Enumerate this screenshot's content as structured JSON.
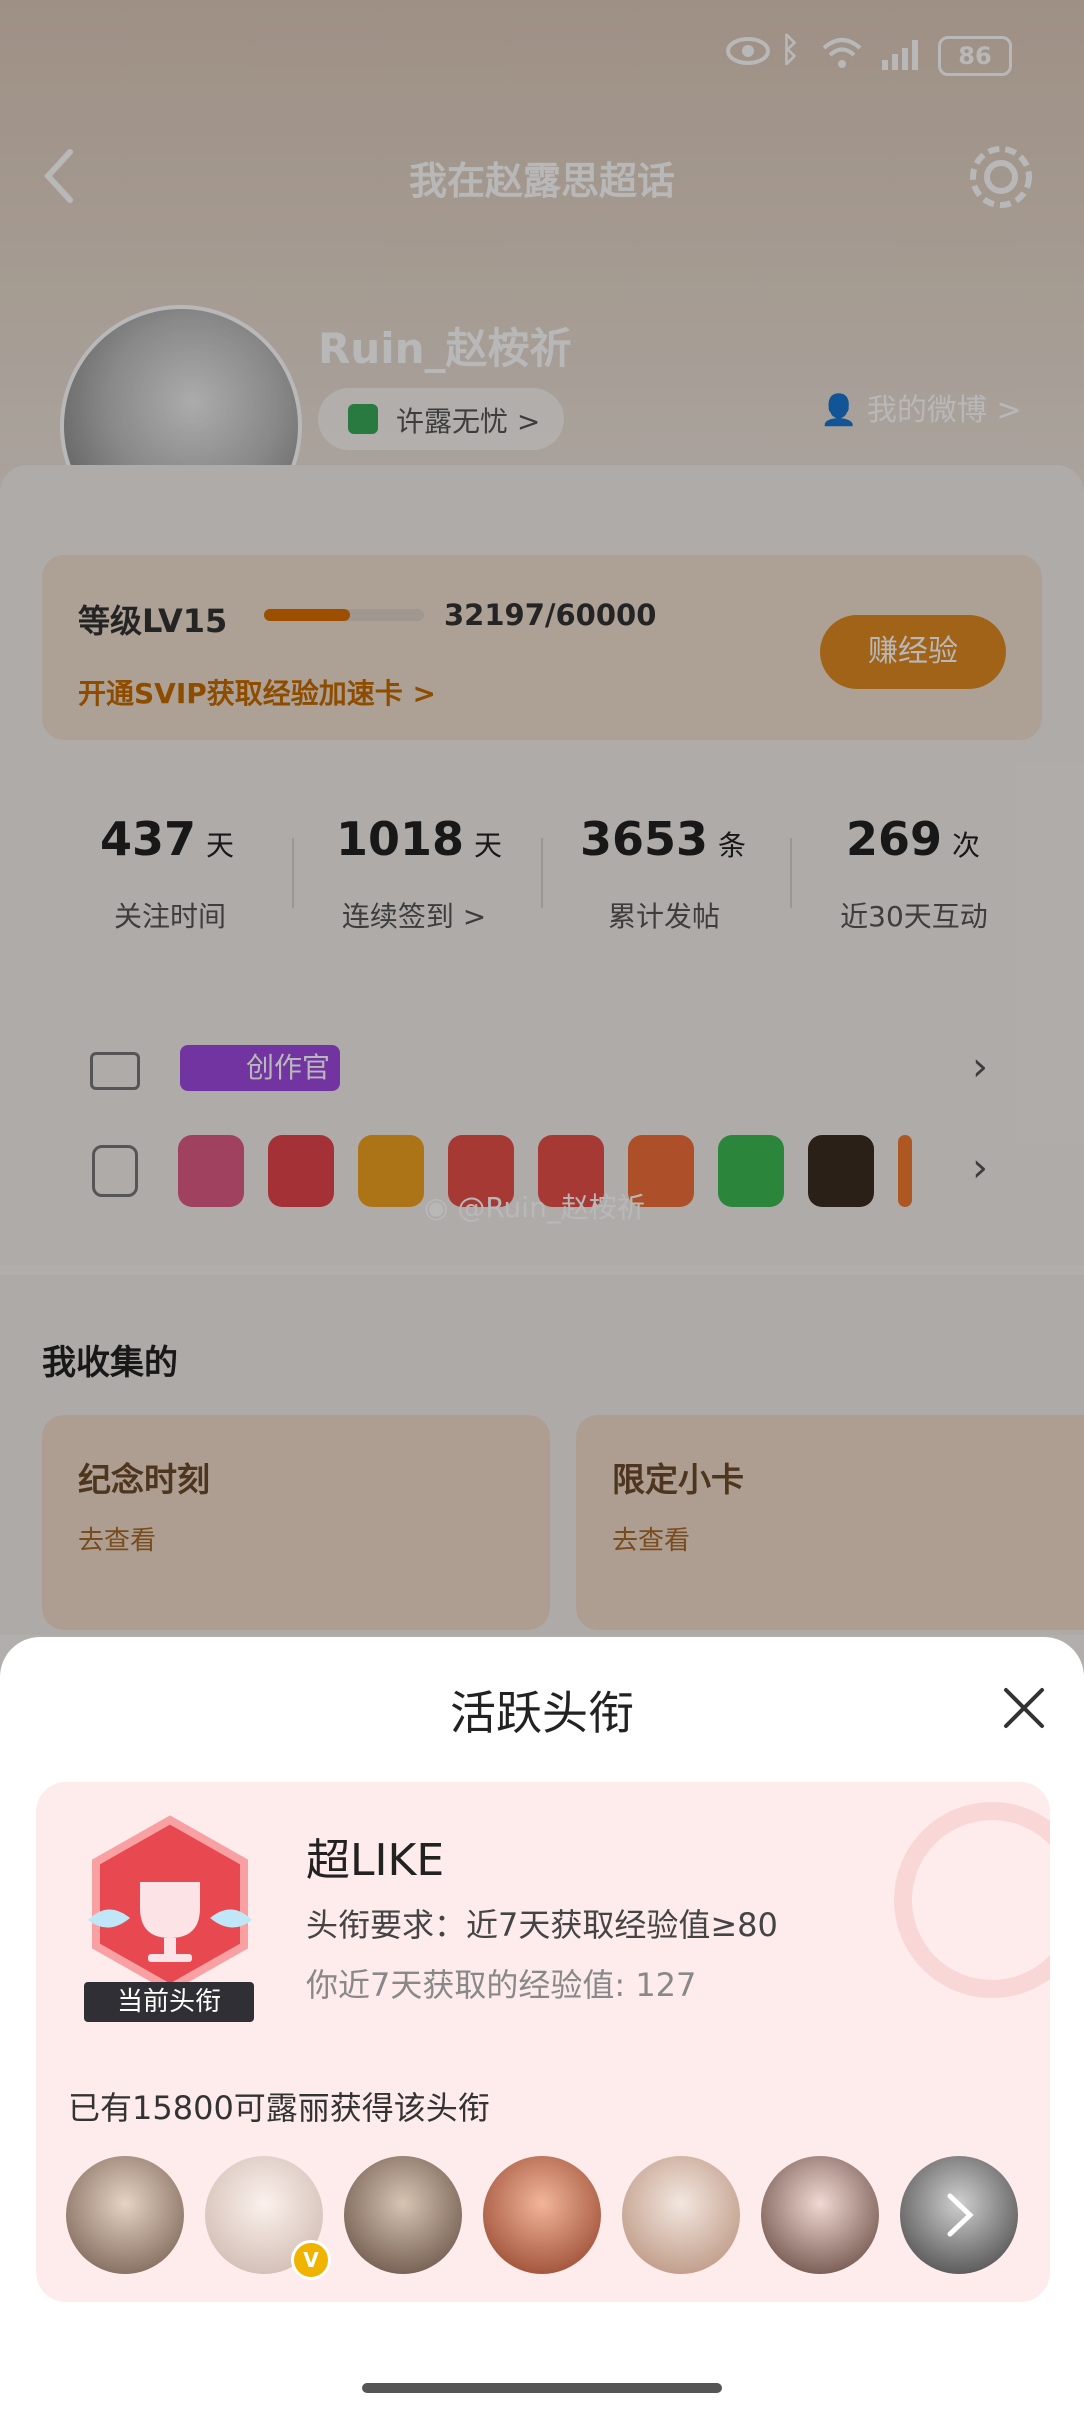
{
  "status": {
    "battery": "86"
  },
  "header": {
    "title": "我在赵露思超话"
  },
  "profile": {
    "name": "Ruin_赵桉祈",
    "tag": "许露无忧 >",
    "my_weibo": "我的微博 >"
  },
  "level": {
    "label": "等级LV15",
    "progress_text": "32197/60000",
    "progress": 0.537,
    "svip_link": "开通SVIP获取经验加速卡 >",
    "earn_button": "赚经验"
  },
  "stats": [
    {
      "value": "437",
      "unit": "天",
      "label": "关注时间"
    },
    {
      "value": "1018",
      "unit": "天",
      "label": "连续签到 >"
    },
    {
      "value": "3653",
      "unit": "条",
      "label": "累计发帖"
    },
    {
      "value": "269",
      "unit": "次",
      "label": "近30天互动"
    }
  ],
  "badges": {
    "creator_badge": "创作官",
    "watermark": "@Ruin_赵桉祈"
  },
  "collection": {
    "section_title": "我收集的",
    "cards": [
      {
        "title": "纪念时刻",
        "action": "去查看"
      },
      {
        "title": "限定小卡",
        "action": "去查看"
      }
    ]
  },
  "sheet": {
    "title": "活跃头衔",
    "honor_name": "超LIKE",
    "requirement": "头衔要求：近7天获取经验值≥80",
    "your_value": "你近7天获取的经验值: 127",
    "current_tag": "当前头衔",
    "holders_text": "已有15800可露丽获得该头衔"
  },
  "colors": {
    "accent_orange": "#e8891a",
    "pink_bg": "#fdeceb",
    "badge_red": "#e8484f"
  }
}
